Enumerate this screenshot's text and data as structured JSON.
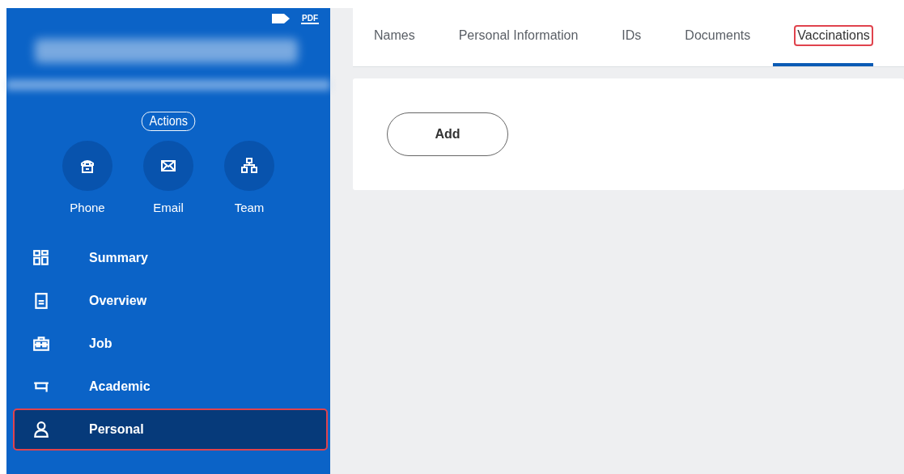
{
  "sidebar": {
    "pdf_label": "PDF",
    "actions_button": "Actions",
    "quick_actions": [
      {
        "kind": "phone",
        "label": "Phone"
      },
      {
        "kind": "email",
        "label": "Email"
      },
      {
        "kind": "team",
        "label": "Team"
      }
    ],
    "items": [
      {
        "kind": "summary",
        "label": "Summary",
        "selected": false,
        "highlighted": false
      },
      {
        "kind": "overview",
        "label": "Overview",
        "selected": false,
        "highlighted": false
      },
      {
        "kind": "job",
        "label": "Job",
        "selected": false,
        "highlighted": false
      },
      {
        "kind": "academic",
        "label": "Academic",
        "selected": false,
        "highlighted": false
      },
      {
        "kind": "personal",
        "label": "Personal",
        "selected": true,
        "highlighted": true
      }
    ]
  },
  "tabs": [
    {
      "label": "Names",
      "selected": false,
      "highlighted": false
    },
    {
      "label": "Personal Information",
      "selected": false,
      "highlighted": false
    },
    {
      "label": "IDs",
      "selected": false,
      "highlighted": false
    },
    {
      "label": "Documents",
      "selected": false,
      "highlighted": false
    },
    {
      "label": "Vaccinations",
      "selected": true,
      "highlighted": true
    }
  ],
  "content": {
    "add_button": "Add"
  }
}
